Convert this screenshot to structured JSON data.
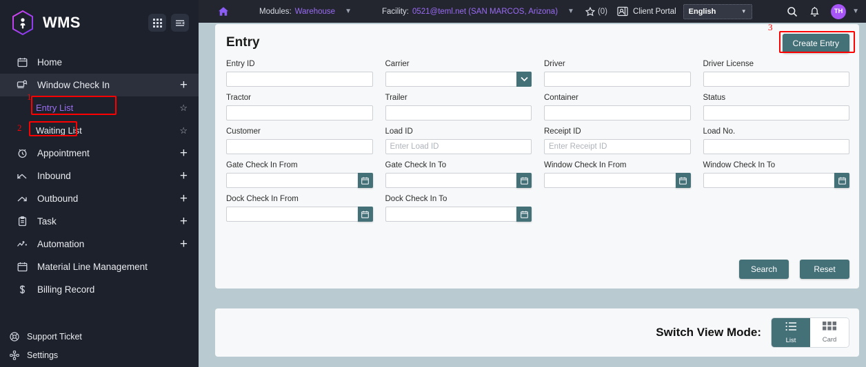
{
  "brand": {
    "title": "WMS",
    "logo_icon": "hexagon-person-icon",
    "grid_icon": "grid-apps-icon",
    "collapse_icon": "collapse-sidebar-icon"
  },
  "sidebar": {
    "items": [
      {
        "label": "Home",
        "icon": "calendar-icon",
        "trailing": "none",
        "active": false,
        "sub": false
      },
      {
        "label": "Window Check In",
        "icon": "truck-window-icon",
        "trailing": "plus",
        "active": true,
        "sub": false
      },
      {
        "label": "Entry List",
        "icon": "none",
        "trailing": "star",
        "active": false,
        "sub": true,
        "selected": true
      },
      {
        "label": "Waiting List",
        "icon": "none",
        "trailing": "star",
        "active": false,
        "sub": true,
        "selected": false
      },
      {
        "label": "Appointment",
        "icon": "alarm-clock-icon",
        "trailing": "plus",
        "active": false,
        "sub": false
      },
      {
        "label": "Inbound",
        "icon": "inbound-arrow-icon",
        "trailing": "plus",
        "active": false,
        "sub": false
      },
      {
        "label": "Outbound",
        "icon": "outbound-arrow-icon",
        "trailing": "plus",
        "active": false,
        "sub": false
      },
      {
        "label": "Task",
        "icon": "clipboard-icon",
        "trailing": "plus",
        "active": false,
        "sub": false
      },
      {
        "label": "Automation",
        "icon": "automation-icon",
        "trailing": "plus",
        "active": false,
        "sub": false
      },
      {
        "label": "Material Line Management",
        "icon": "calendar-icon",
        "trailing": "none",
        "active": false,
        "sub": false
      },
      {
        "label": "Billing Record",
        "icon": "dollar-icon",
        "trailing": "none",
        "active": false,
        "sub": false
      }
    ],
    "bottom_items": [
      {
        "label": "Support Ticket",
        "icon": "lifebuoy-icon"
      },
      {
        "label": "Settings",
        "icon": "settings-nodes-icon"
      }
    ]
  },
  "topbar": {
    "home_icon": "home-icon",
    "modules_label": "Modules:",
    "modules_value": "Warehouse",
    "facility_label": "Facility:",
    "facility_value": "0521@teml.net  (SAN MARCOS, Arizona)",
    "favorites_count": "(0)",
    "star_icon": "star-icon",
    "client_portal_icon": "client-portal-icon",
    "client_portal_label": "Client Portal",
    "language": "English",
    "search_icon": "search-icon",
    "bell_icon": "notification-bell-icon",
    "avatar_initials": "TH",
    "avatar_chevron": "chevron-down-icon"
  },
  "entry_card": {
    "title": "Entry",
    "create_button": "Create Entry",
    "rows": [
      [
        {
          "label": "Entry ID",
          "type": "text",
          "value": "",
          "placeholder": ""
        },
        {
          "label": "Carrier",
          "type": "select",
          "value": "",
          "placeholder": ""
        },
        {
          "label": "Driver",
          "type": "text",
          "value": "",
          "placeholder": ""
        },
        {
          "label": "Driver License",
          "type": "text",
          "value": "",
          "placeholder": ""
        }
      ],
      [
        {
          "label": "Tractor",
          "type": "text",
          "value": "",
          "placeholder": ""
        },
        {
          "label": "Trailer",
          "type": "text",
          "value": "",
          "placeholder": ""
        },
        {
          "label": "Container",
          "type": "text",
          "value": "",
          "placeholder": ""
        },
        {
          "label": "Status",
          "type": "text",
          "value": "",
          "placeholder": ""
        }
      ],
      [
        {
          "label": "Customer",
          "type": "text",
          "value": "",
          "placeholder": ""
        },
        {
          "label": "Load ID",
          "type": "text",
          "value": "",
          "placeholder": "Enter Load ID"
        },
        {
          "label": "Receipt ID",
          "type": "text",
          "value": "",
          "placeholder": "Enter Receipt ID"
        },
        {
          "label": "Load No.",
          "type": "text",
          "value": "",
          "placeholder": ""
        }
      ],
      [
        {
          "label": "Gate Check In From",
          "type": "date",
          "value": "",
          "placeholder": ""
        },
        {
          "label": "Gate Check In To",
          "type": "date",
          "value": "",
          "placeholder": ""
        },
        {
          "label": "Window Check In From",
          "type": "date",
          "value": "",
          "placeholder": ""
        },
        {
          "label": "Window Check In To",
          "type": "date",
          "value": "",
          "placeholder": ""
        }
      ],
      [
        {
          "label": "Dock Check In From",
          "type": "date",
          "value": "",
          "placeholder": ""
        },
        {
          "label": "Dock Check In To",
          "type": "date",
          "value": "",
          "placeholder": ""
        },
        {
          "label": "",
          "type": "empty",
          "value": "",
          "placeholder": ""
        },
        {
          "label": "",
          "type": "empty",
          "value": "",
          "placeholder": ""
        }
      ]
    ],
    "search_button": "Search",
    "reset_button": "Reset"
  },
  "view_mode": {
    "label": "Switch View Mode:",
    "options": [
      {
        "label": "List",
        "icon": "list-view-icon",
        "active": true
      },
      {
        "label": "Card",
        "icon": "card-view-icon",
        "active": false
      }
    ]
  },
  "annotations": [
    {
      "number": "1",
      "target": "window-check-in"
    },
    {
      "number": "2",
      "target": "entry-list"
    },
    {
      "number": "3",
      "target": "create-entry"
    }
  ],
  "colors": {
    "sidebar_bg": "#1d212b",
    "topbar_bg": "#23262f",
    "page_bg": "#b9cbd1",
    "card_bg": "#f7f8f9",
    "accent_teal": "#447078",
    "accent_purple": "#9a6bf5",
    "annotation_red": "#ff0000"
  }
}
